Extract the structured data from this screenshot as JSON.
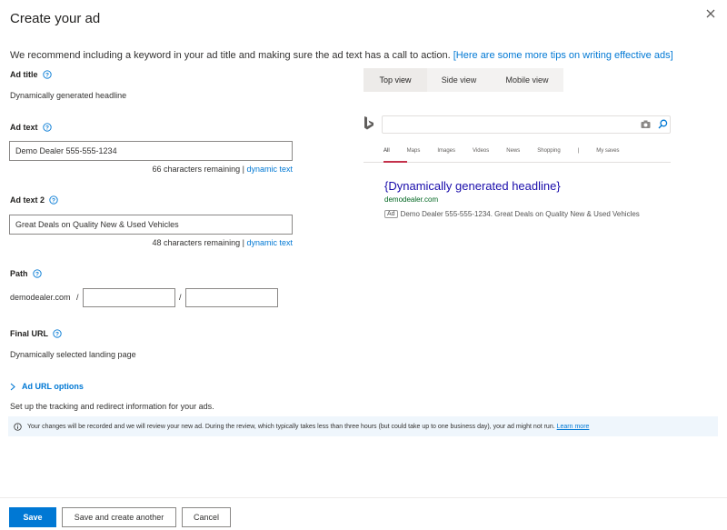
{
  "dialog": {
    "title": "Create your ad",
    "intro_text": "We recommend including a keyword in your ad title and making sure the ad text has a call to action.",
    "intro_link": "[Here are some more tips on writing effective ads]"
  },
  "form": {
    "ad_title": {
      "label": "Ad title",
      "value": "Dynamically generated headline"
    },
    "ad_text": {
      "label": "Ad text",
      "value": "Demo Dealer 555-555-1234",
      "remaining": "66 characters remaining",
      "separator": "|",
      "link": "dynamic text"
    },
    "ad_text2": {
      "label": "Ad text 2",
      "value": "Great Deals on Quality New & Used Vehicles",
      "remaining": "48 characters remaining",
      "separator": "|",
      "link": "dynamic text"
    },
    "path": {
      "label": "Path",
      "domain": "demodealer.com",
      "slash": "/",
      "path1": "",
      "path2": ""
    },
    "final_url": {
      "label": "Final URL",
      "value": "Dynamically selected landing page"
    },
    "ad_url_options": {
      "label": "Ad URL options",
      "description": "Set up the tracking and redirect information for your ads."
    }
  },
  "preview": {
    "tabs": [
      "Top view",
      "Side view",
      "Mobile view"
    ],
    "active_tab": "Top view",
    "search_nav": [
      "All",
      "Maps",
      "Images",
      "Videos",
      "News",
      "Shopping",
      "|",
      "My saves"
    ],
    "ad": {
      "headline": "{Dynamically generated headline}",
      "display_url": "demodealer.com",
      "badge": "Ad",
      "description": "Demo Dealer 555-555-1234. Great Deals on Quality New & Used Vehicles"
    }
  },
  "notice": {
    "text": "Your changes will be recorded and we will review your new ad. During the review, which typically takes less than three hours (but could take up to one business day), your ad might not run.",
    "link": "Learn more"
  },
  "footer": {
    "save": "Save",
    "save_another": "Save and create another",
    "cancel": "Cancel"
  },
  "colors": {
    "accent": "#0078d4",
    "ad_headline": "#1a0dab",
    "ad_url": "#006621",
    "info_bg": "#eff6fc",
    "bing_nav_active": "#c4314b"
  }
}
